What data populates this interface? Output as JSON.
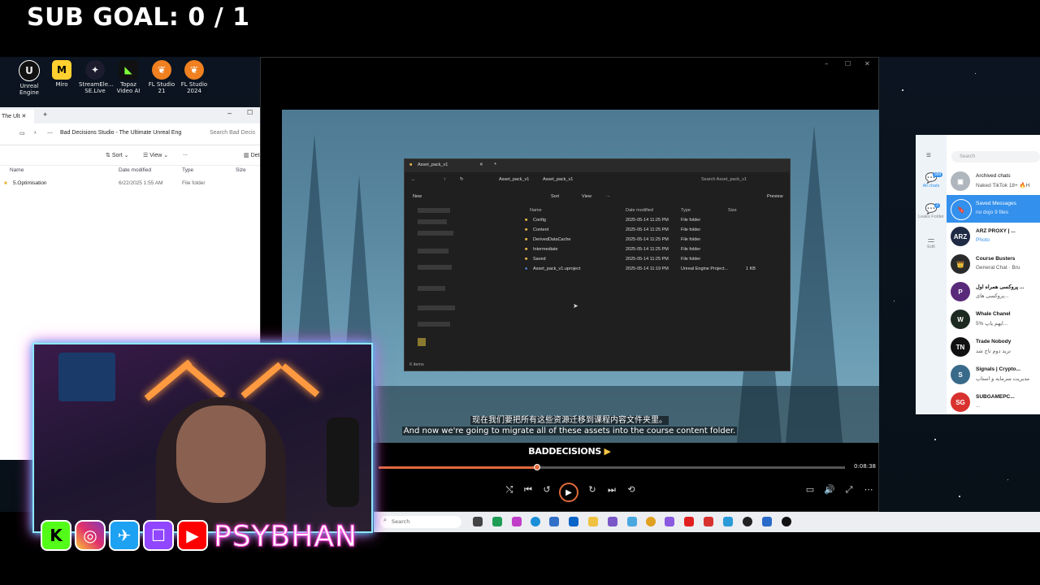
{
  "overlay": {
    "sub_goal": "SUB GOAL: 0 / 1",
    "streamer_name": "PSYBHAN"
  },
  "desktop_icons": [
    {
      "label": "Unreal Engine",
      "icon": "unreal-icon",
      "color": "#111111"
    },
    {
      "label": "Miro",
      "icon": "miro-icon",
      "color": "#ffd02f"
    },
    {
      "label": "StreamEle... SE.Live",
      "icon": "streamelements-icon",
      "color": "#1c1c2e"
    },
    {
      "label": "Topaz Video AI",
      "icon": "topaz-icon",
      "color": "#111111"
    },
    {
      "label": "FL Studio 21",
      "icon": "flstudio-icon",
      "color": "#f08020"
    },
    {
      "label": "FL Studio 2024",
      "icon": "flstudio-icon",
      "color": "#f08020"
    }
  ],
  "explorer": {
    "tab_title": "The Ult",
    "address": "Bad Decisions Studio - The Ultimate Unreal Eng",
    "search_placeholder": "Search Bad Decis",
    "toolbar": {
      "sort": "Sort",
      "view": "View",
      "more": "...",
      "details": "Details"
    },
    "columns": [
      "Name",
      "Date modified",
      "Type",
      "Size"
    ],
    "rows": [
      {
        "name": "5.Optimisation",
        "date": "6/22/2025 1:55 AM",
        "type": "File folder",
        "size": ""
      }
    ]
  },
  "video_player": {
    "inner_window": {
      "tab_title": "Asset_pack_v1",
      "breadcrumb": [
        "Asset_pack_v1",
        "Asset_pack_v1"
      ],
      "search_placeholder": "Search Asset_pack_v1",
      "toolbar": {
        "new": "New",
        "sort": "Sort",
        "view": "View",
        "more": "...",
        "preview": "Preview"
      },
      "columns": [
        "Name",
        "Date modified",
        "Type",
        "Size"
      ],
      "rows": [
        {
          "name": "Config",
          "date": "2025-05-14 11:25 PM",
          "type": "File folder",
          "size": ""
        },
        {
          "name": "Content",
          "date": "2025-05-14 11:25 PM",
          "type": "File folder",
          "size": ""
        },
        {
          "name": "DerivedDataCache",
          "date": "2025-05-14 11:25 PM",
          "type": "File folder",
          "size": ""
        },
        {
          "name": "Intermediate",
          "date": "2025-05-14 11:25 PM",
          "type": "File folder",
          "size": ""
        },
        {
          "name": "Saved",
          "date": "2025-05-14 11:25 PM",
          "type": "File folder",
          "size": ""
        },
        {
          "name": "Asset_pack_v1.uproject",
          "date": "2025-05-14 11:19 PM",
          "type": "Unreal Engine Project...",
          "size": "1 KB"
        }
      ],
      "status": "6 items"
    },
    "subtitle_zh": "现在我们要把所有这些资源迁移到课程内容文件夹里。",
    "subtitle_en": "And now we're going to migrate all of these assets into the course content folder.",
    "brand": "BADDECISIONS",
    "time": "0:08:38",
    "progress": 0.34
  },
  "telegram": {
    "search_placeholder": "Search",
    "folders": [
      {
        "label": "All chats",
        "badge": "999"
      },
      {
        "label": "Leaks Folder",
        "badge": "3"
      },
      {
        "label": "Edit",
        "badge": ""
      }
    ],
    "chats": [
      {
        "name": "Archived chats",
        "msg": "Naked TikTok 18+ 🔥H",
        "color": "#b0b6bd",
        "initials": "▣"
      },
      {
        "name": "Saved Messages",
        "msg": "no dojo 9 files",
        "color": "#3390ec",
        "initials": "🔖"
      },
      {
        "name": "ARZ PROXY | ...",
        "msg": "Photo",
        "color": "#1f2a44",
        "initials": "ARZ"
      },
      {
        "name": "Course Busters",
        "msg": "General Chat · Bru",
        "color": "#2b2b2b",
        "initials": "👑"
      },
      {
        "name": "پروکسی همراه اول ...",
        "msg": "پروکسی های...",
        "color": "#5a2a7a",
        "initials": "P"
      },
      {
        "name": "Whale Chanel",
        "msg": "5% ایهم ياپ...",
        "color": "#1d2a22",
        "initials": "W"
      },
      {
        "name": "Trade Nobody",
        "msg": "ترید دوم تاج شد",
        "color": "#111111",
        "initials": "TN"
      },
      {
        "name": "Signals | Crypto...",
        "msg": "مدیریت سرمایه و استاپ",
        "color": "#3a6a8a",
        "initials": "S"
      },
      {
        "name": "SUBGAMEPC...",
        "msg": "...",
        "color": "#d8322f",
        "initials": "SG"
      }
    ]
  },
  "taskbar": {
    "search_placeholder": "Search"
  }
}
